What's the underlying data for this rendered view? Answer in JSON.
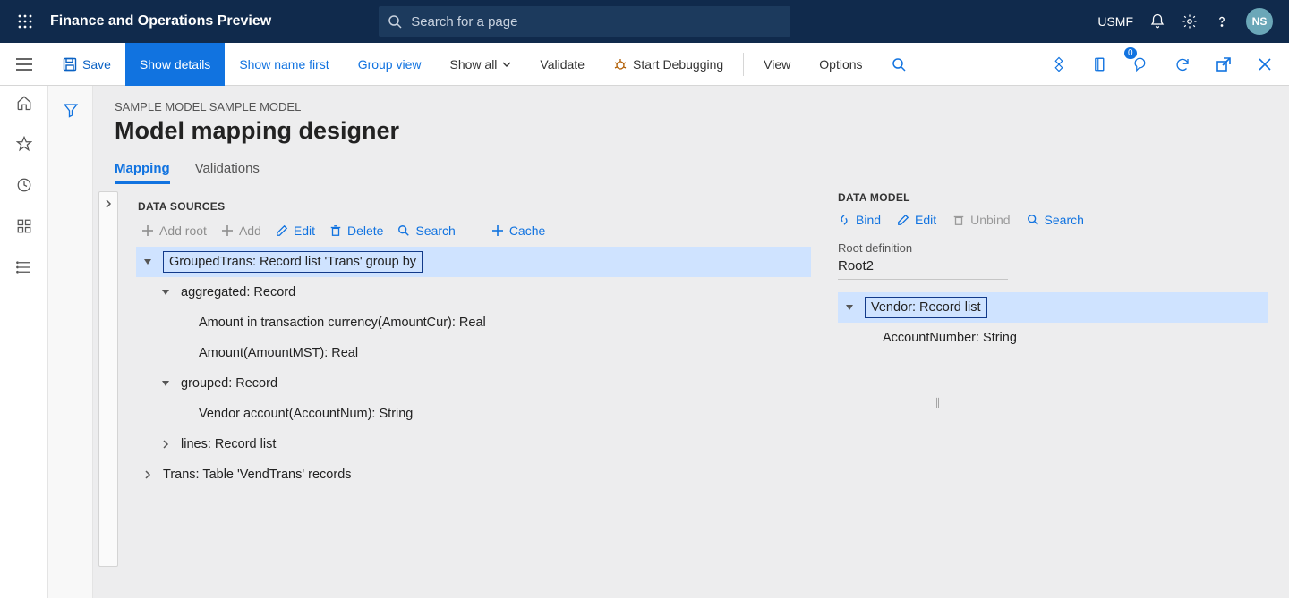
{
  "header": {
    "app_title": "Finance and Operations Preview",
    "search_placeholder": "Search for a page",
    "company": "USMF",
    "avatar": "NS"
  },
  "actionbar": {
    "save": "Save",
    "show_details": "Show details",
    "show_name_first": "Show name first",
    "group_view": "Group view",
    "show_all": "Show all",
    "validate": "Validate",
    "start_debugging": "Start Debugging",
    "view": "View",
    "options": "Options"
  },
  "page": {
    "breadcrumb": "SAMPLE MODEL SAMPLE MODEL",
    "title": "Model mapping designer",
    "tabs": {
      "mapping": "Mapping",
      "validations": "Validations"
    }
  },
  "data_sources": {
    "header": "DATA SOURCES",
    "toolbar": {
      "add_root": "Add root",
      "add": "Add",
      "edit": "Edit",
      "delete": "Delete",
      "search": "Search",
      "cache": "Cache"
    },
    "tree": {
      "grouped_trans": "GroupedTrans: Record list 'Trans' group by",
      "aggregated": "aggregated: Record",
      "amount_cur": "Amount in transaction currency(AmountCur): Real",
      "amount_mst": "Amount(AmountMST): Real",
      "grouped": "grouped: Record",
      "vendor_account": "Vendor account(AccountNum): String",
      "lines": "lines: Record list",
      "trans": "Trans: Table 'VendTrans' records"
    }
  },
  "data_model": {
    "header": "DATA MODEL",
    "toolbar": {
      "bind": "Bind",
      "edit": "Edit",
      "unbind": "Unbind",
      "search": "Search"
    },
    "root_def_label": "Root definition",
    "root_def_value": "Root2",
    "tree": {
      "vendor": "Vendor: Record list",
      "account_number": "AccountNumber: String"
    }
  }
}
